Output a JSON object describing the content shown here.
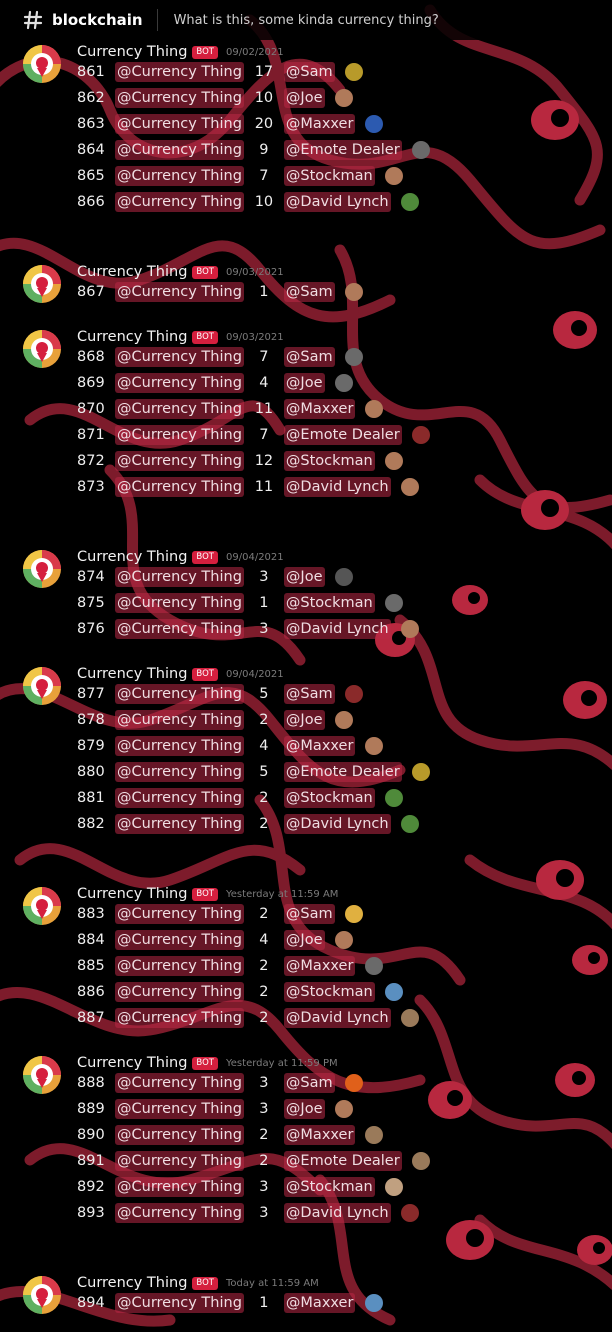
{
  "header": {
    "channel": "blockchain",
    "topic": "What is this, some kinda currency thing?"
  },
  "colors": {
    "background": "#000000",
    "squiggle": "#8b1f30",
    "eye": "#b8283f",
    "mention_bg": "#b92846",
    "bot_badge": "#d51f3e"
  },
  "groups": [
    {
      "author": "Currency Thing",
      "badge": "BOT",
      "timestamp": "09/02/2021",
      "rows": [
        {
          "num": "861",
          "mention": "@Currency Thing",
          "amount": "17",
          "user": "@Sam",
          "emoji": "gold-scene-emoji"
        },
        {
          "num": "862",
          "mention": "@Currency Thing",
          "amount": "10",
          "user": "@Joe",
          "emoji": "face-emoji"
        },
        {
          "num": "863",
          "mention": "@Currency Thing",
          "amount": "20",
          "user": "@Maxxer",
          "emoji": "flag-emoji"
        },
        {
          "num": "864",
          "mention": "@Currency Thing",
          "amount": "9",
          "user": "@Emote Dealer",
          "emoji": "skull-emoji"
        },
        {
          "num": "865",
          "mention": "@Currency Thing",
          "amount": "7",
          "user": "@Stockman",
          "emoji": "face-emoji"
        },
        {
          "num": "866",
          "mention": "@Currency Thing",
          "amount": "10",
          "user": "@David Lynch",
          "emoji": "green-box-emoji"
        }
      ]
    },
    {
      "author": "Currency Thing",
      "badge": "BOT",
      "timestamp": "09/03/2021",
      "rows": [
        {
          "num": "867",
          "mention": "@Currency Thing",
          "amount": "1",
          "user": "@Sam",
          "emoji": "face-emoji"
        }
      ]
    },
    {
      "author": "Currency Thing",
      "badge": "BOT",
      "timestamp": "09/03/2021",
      "rows": [
        {
          "num": "868",
          "mention": "@Currency Thing",
          "amount": "7",
          "user": "@Sam",
          "emoji": "skull-emoji"
        },
        {
          "num": "869",
          "mention": "@Currency Thing",
          "amount": "4",
          "user": "@Joe",
          "emoji": "skull-emoji"
        },
        {
          "num": "870",
          "mention": "@Currency Thing",
          "amount": "11",
          "user": "@Maxxer",
          "emoji": "face-emoji"
        },
        {
          "num": "871",
          "mention": "@Currency Thing",
          "amount": "7",
          "user": "@Emote Dealer",
          "emoji": "red-box-emoji"
        },
        {
          "num": "872",
          "mention": "@Currency Thing",
          "amount": "12",
          "user": "@Stockman",
          "emoji": "face-emoji"
        },
        {
          "num": "873",
          "mention": "@Currency Thing",
          "amount": "11",
          "user": "@David Lynch",
          "emoji": "face-emoji"
        }
      ]
    },
    {
      "author": "Currency Thing",
      "badge": "BOT",
      "timestamp": "09/04/2021",
      "rows": [
        {
          "num": "874",
          "mention": "@Currency Thing",
          "amount": "3",
          "user": "@Joe",
          "emoji": "gun-emoji"
        },
        {
          "num": "875",
          "mention": "@Currency Thing",
          "amount": "1",
          "user": "@Stockman",
          "emoji": "skull-emoji"
        },
        {
          "num": "876",
          "mention": "@Currency Thing",
          "amount": "3",
          "user": "@David Lynch",
          "emoji": "face-emoji"
        }
      ]
    },
    {
      "author": "Currency Thing",
      "badge": "BOT",
      "timestamp": "09/04/2021",
      "rows": [
        {
          "num": "877",
          "mention": "@Currency Thing",
          "amount": "5",
          "user": "@Sam",
          "emoji": "red-box-emoji"
        },
        {
          "num": "878",
          "mention": "@Currency Thing",
          "amount": "2",
          "user": "@Joe",
          "emoji": "face-emoji"
        },
        {
          "num": "879",
          "mention": "@Currency Thing",
          "amount": "4",
          "user": "@Maxxer",
          "emoji": "face-emoji"
        },
        {
          "num": "880",
          "mention": "@Currency Thing",
          "amount": "5",
          "user": "@Emote Dealer",
          "emoji": "gold-scene-emoji"
        },
        {
          "num": "881",
          "mention": "@Currency Thing",
          "amount": "2",
          "user": "@Stockman",
          "emoji": "green-box-emoji"
        },
        {
          "num": "882",
          "mention": "@Currency Thing",
          "amount": "2",
          "user": "@David Lynch",
          "emoji": "green-box-emoji"
        }
      ]
    },
    {
      "author": "Currency Thing",
      "badge": "BOT",
      "timestamp": "Yesterday at 11:59 AM",
      "rows": [
        {
          "num": "883",
          "mention": "@Currency Thing",
          "amount": "2",
          "user": "@Sam",
          "emoji": "bread-emoji"
        },
        {
          "num": "884",
          "mention": "@Currency Thing",
          "amount": "4",
          "user": "@Joe",
          "emoji": "face-emoji"
        },
        {
          "num": "885",
          "mention": "@Currency Thing",
          "amount": "2",
          "user": "@Maxxer",
          "emoji": "skull-emoji"
        },
        {
          "num": "886",
          "mention": "@Currency Thing",
          "amount": "2",
          "user": "@Stockman",
          "emoji": "shark-emoji"
        },
        {
          "num": "887",
          "mention": "@Currency Thing",
          "amount": "2",
          "user": "@David Lynch",
          "emoji": "figure-emoji"
        }
      ]
    },
    {
      "author": "Currency Thing",
      "badge": "BOT",
      "timestamp": "Yesterday at 11:59 PM",
      "rows": [
        {
          "num": "888",
          "mention": "@Currency Thing",
          "amount": "3",
          "user": "@Sam",
          "emoji": "pumpkin-emoji"
        },
        {
          "num": "889",
          "mention": "@Currency Thing",
          "amount": "3",
          "user": "@Joe",
          "emoji": "face-emoji"
        },
        {
          "num": "890",
          "mention": "@Currency Thing",
          "amount": "2",
          "user": "@Maxxer",
          "emoji": "figure-emoji"
        },
        {
          "num": "891",
          "mention": "@Currency Thing",
          "amount": "2",
          "user": "@Emote Dealer",
          "emoji": "figure-emoji"
        },
        {
          "num": "892",
          "mention": "@Currency Thing",
          "amount": "3",
          "user": "@Stockman",
          "emoji": "cow-emoji"
        },
        {
          "num": "893",
          "mention": "@Currency Thing",
          "amount": "3",
          "user": "@David Lynch",
          "emoji": "red-box-emoji"
        }
      ]
    },
    {
      "author": "Currency Thing",
      "badge": "BOT",
      "timestamp": "Today at 11:59 AM",
      "rows": [
        {
          "num": "894",
          "mention": "@Currency Thing",
          "amount": "1",
          "user": "@Maxxer",
          "emoji": "shark-emoji"
        }
      ]
    }
  ]
}
